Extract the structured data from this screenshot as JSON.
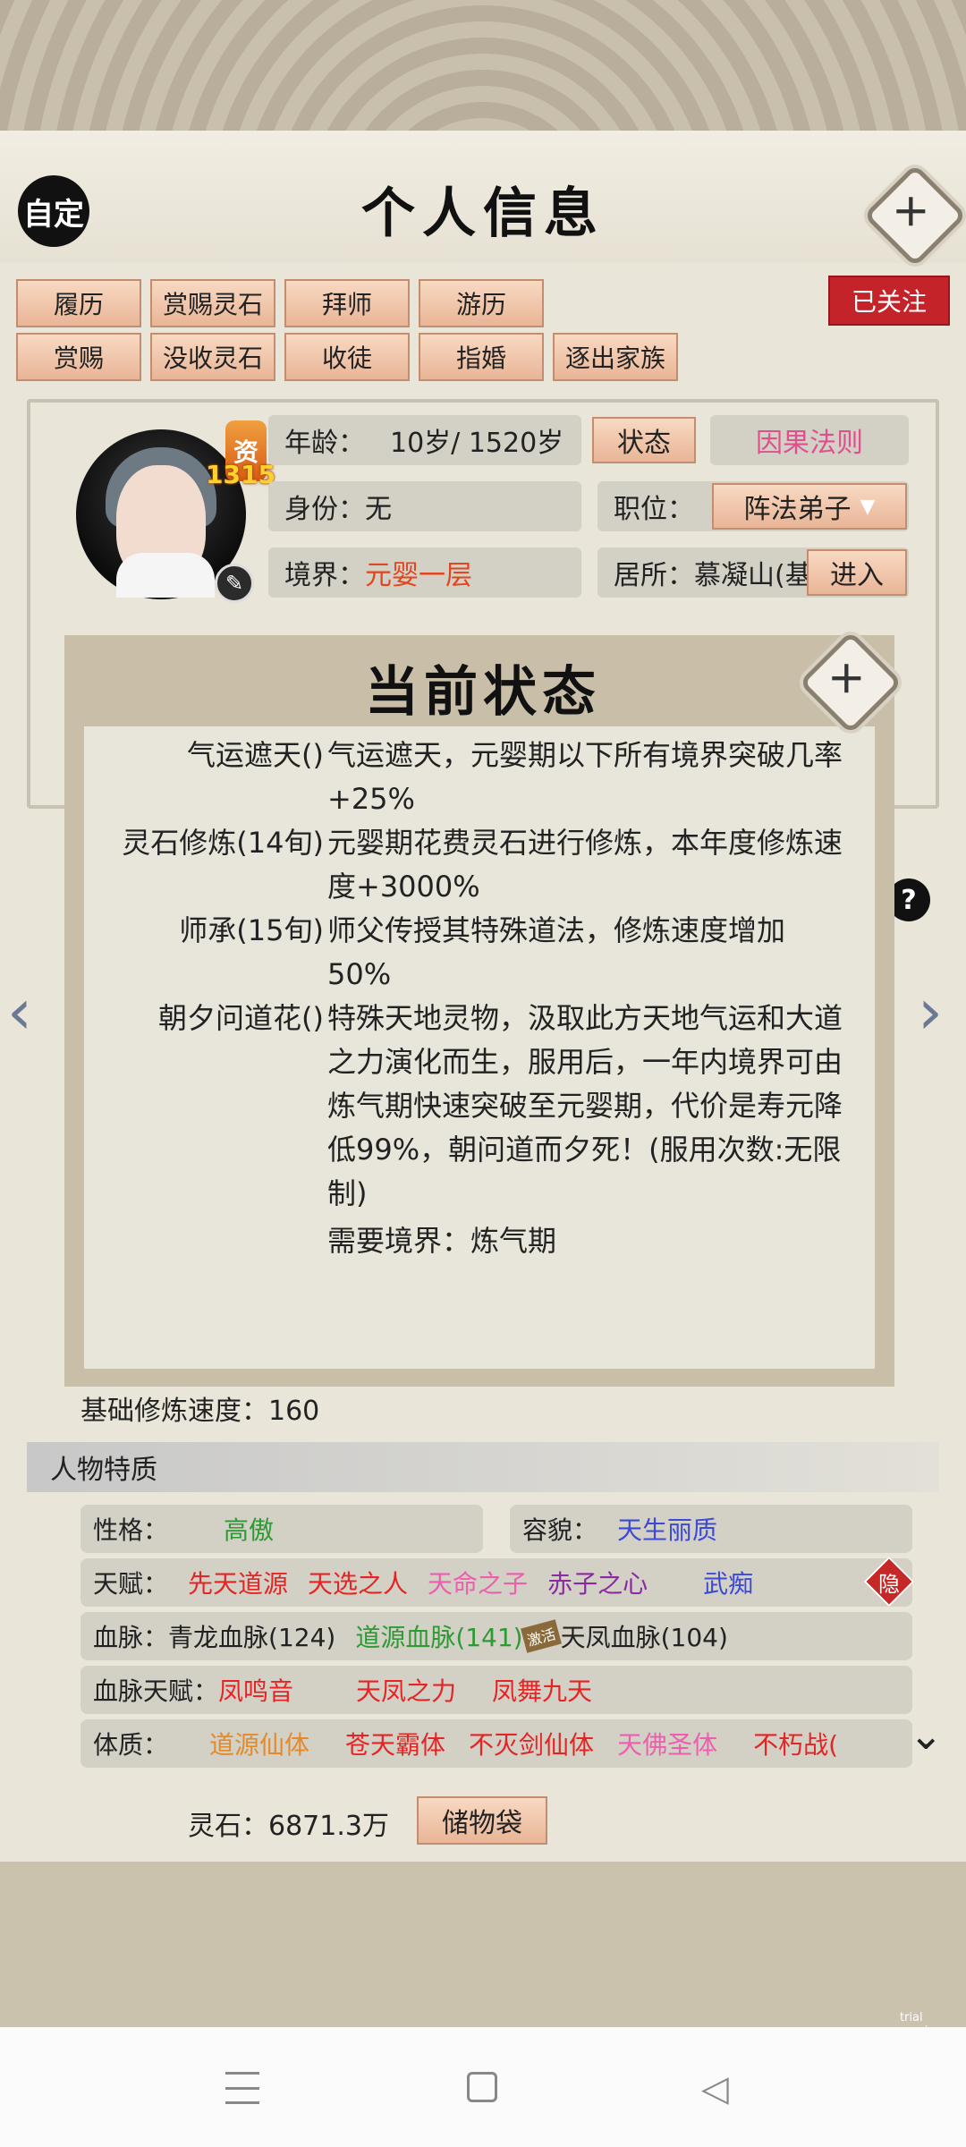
{
  "header": {
    "custom_label": "自定",
    "title": "个人信息"
  },
  "action_buttons": {
    "row1": [
      "履历",
      "赏赐灵石",
      "拜师",
      "游历"
    ],
    "row2": [
      "赏赐",
      "没收灵石",
      "收徒",
      "指婚",
      "逐出家族"
    ],
    "followed": "已关注"
  },
  "character": {
    "aptitude_label": "资",
    "aptitude_value": "1315",
    "age_label": "年龄：",
    "age_value": "10岁/ 1520岁",
    "status_button": "状态",
    "karma_button": "因果法则",
    "identity_label": "身份：",
    "identity_value": "无",
    "position_label": "职位：",
    "position_value": "阵法弟子",
    "realm_label": "境界：",
    "realm_value": "元婴一层",
    "residence_label": "居所：",
    "residence_value": "慕凝山(基",
    "enter_button": "进入"
  },
  "modal": {
    "title": "当前状态",
    "statuses": [
      {
        "name": "气运遮天()",
        "desc": "气运遮天，元婴期以下所有境界突破几率+25%"
      },
      {
        "name": "灵石修炼(14旬)",
        "desc": "元婴期花费灵石进行修炼，本年度修炼速度+3000%"
      },
      {
        "name": "师承(15旬)",
        "desc": "师父传授其特殊道法，修炼速度增加50%"
      },
      {
        "name": "朝夕问道花()",
        "desc": "特殊天地灵物，汲取此方天地气运和大道之力演化而生，服用后，一年内境界可由炼气期快速突破至元婴期，代价是寿元降低99%，朝问道而夕死！(服用次数:无限制)"
      }
    ],
    "requirement": "需要境界：炼气期"
  },
  "base_speed": "基础修炼速度：160",
  "traits": {
    "section_title": "人物特质",
    "personality_label": "性格：",
    "personality_value": "高傲",
    "appearance_label": "容貌：",
    "appearance_value": "天生丽质",
    "talent_label": "天赋：",
    "talents": [
      "先天道源",
      "天选之人",
      "天命之子",
      "赤子之心",
      "武痴"
    ],
    "hide_label": "隐",
    "bloodline_label": "血脉：",
    "bloodlines": [
      "青龙血脉(124)",
      "道源血脉(141)",
      "天凤血脉(104)"
    ],
    "bloodline_badge": "激活",
    "bloodline_talent_label": "血脉天赋：",
    "bloodline_talents": [
      "凤鸣音",
      "天凤之力",
      "凤舞九天"
    ],
    "physique_label": "体质：",
    "physiques": [
      "道源仙体",
      "苍天霸体",
      "不灭剑仙体",
      "天佛圣体",
      "不朽战("
    ]
  },
  "footer": {
    "spirit_stones": "灵石：6871.3万",
    "bag_button": "储物袋"
  },
  "watermark": "trial version",
  "colors": {
    "accent_red": "#c5232a",
    "button_peach": "#f3c8ad",
    "orange_text": "#e2461e",
    "pink_text": "#e0508e"
  }
}
